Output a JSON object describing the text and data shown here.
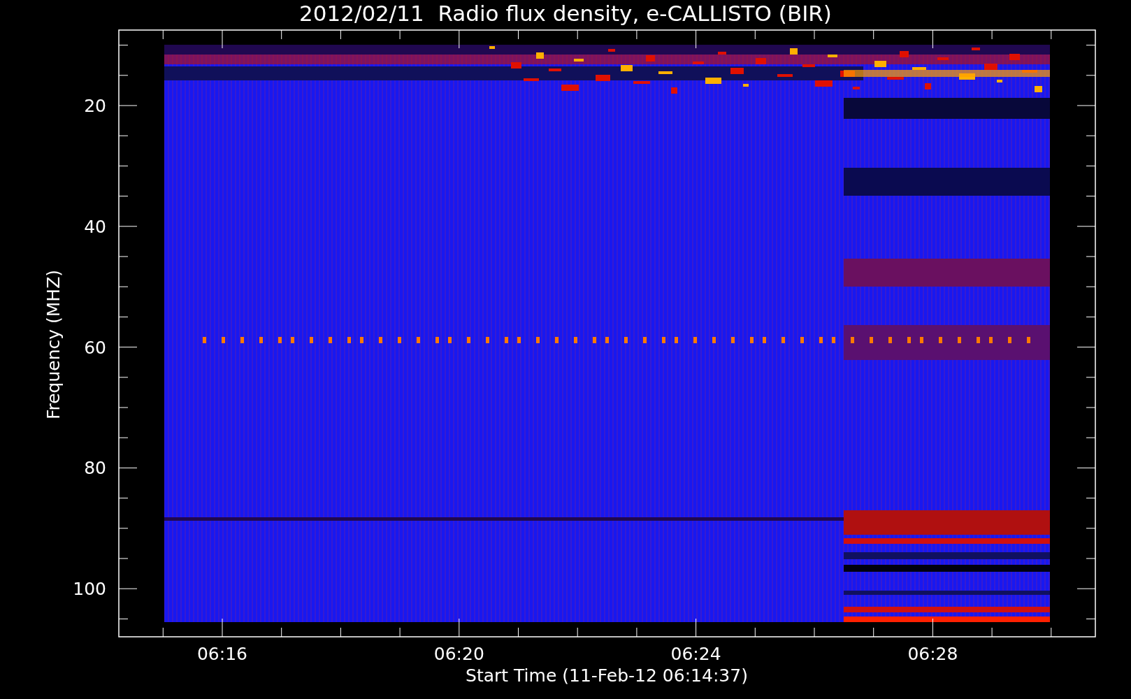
{
  "title": "2012/02/11  Radio flux density, e-CALLISTO (BIR)",
  "y_axis": {
    "label": "Frequency (MHZ)",
    "ticks": [
      "20",
      "40",
      "60",
      "80",
      "100"
    ]
  },
  "x_axis": {
    "label": "Start Time (11-Feb-12 06:14:37)",
    "ticks": [
      "06:16",
      "06:20",
      "06:24",
      "06:28"
    ]
  }
}
